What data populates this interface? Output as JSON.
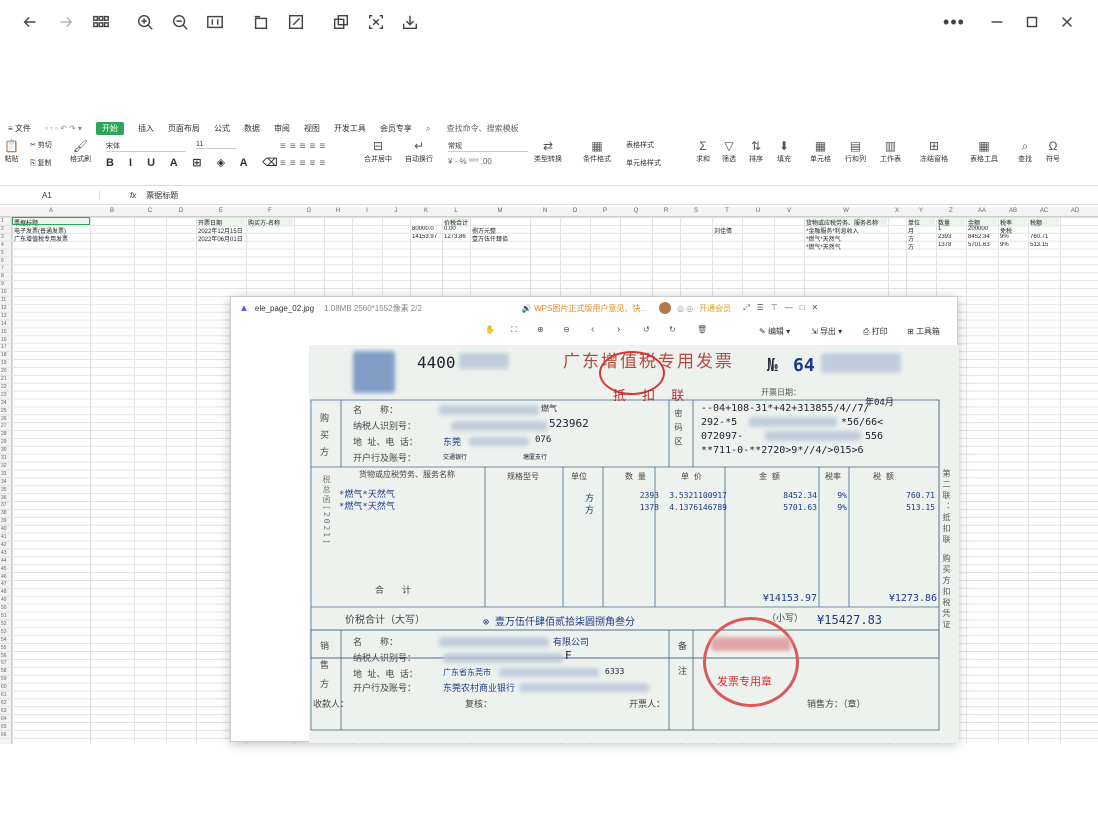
{
  "viewer": {
    "icons": [
      "back-icon",
      "forward-icon",
      "grid-icon",
      "zoom-in-icon",
      "zoom-out-icon",
      "fit-icon",
      "rotate-icon",
      "edit-icon",
      "copy-icon",
      "crop-icon",
      "download-icon",
      "more-icon",
      "minimize-icon",
      "maximize-icon",
      "close-icon"
    ]
  },
  "menu": {
    "items": [
      "≡ 文件",
      "开始",
      "插入",
      "页面布局",
      "公式",
      "数据",
      "审阅",
      "视图",
      "开发工具",
      "会员专享",
      "查找命令、搜索模板"
    ],
    "active": "开始"
  },
  "ribbon": {
    "paste": "粘贴",
    "cut": "剪切",
    "copy": "复制",
    "format_painter": "格式刷",
    "font": "宋体",
    "size": "11",
    "merge": "合并居中",
    "wrap": "自动换行",
    "number_format": "常规",
    "type_convert": "类型转换",
    "cond_format": "条件格式",
    "table_style": "表格样式",
    "cell_style": "单元格样式",
    "sum": "求和",
    "filter": "筛选",
    "sort": "排序",
    "fill": "填充",
    "cell": "单元格",
    "rowcol": "行和列",
    "sheet": "工作表",
    "freeze": "冻结窗格",
    "table_tools": "表格工具",
    "find": "查找",
    "symbol": "符号"
  },
  "formula": {
    "cell_ref": "A1",
    "fx": "fx",
    "content": "票据标题"
  },
  "columns": [
    "A",
    "B",
    "C",
    "D",
    "E",
    "F",
    "G",
    "H",
    "I",
    "J",
    "K",
    "L",
    "M",
    "N",
    "O",
    "P",
    "Q",
    "R",
    "S",
    "T",
    "U",
    "V",
    "W",
    "X",
    "Y",
    "Z",
    "AA",
    "AB",
    "AC",
    "AD"
  ],
  "rows": [
    {
      "n": "1",
      "a": "票据标题",
      "e": "开票日期",
      "f": "购买方-名称",
      "l": "价税合计",
      "w": "货物或应税劳务、服务名称",
      "y": "单位",
      "z": "数量",
      "aa": "金额",
      "ab": "税率",
      "ac": "税额"
    },
    {
      "n": "2",
      "a": "电子发票(普通发票)",
      "e": "2022年12月15日",
      "k": "80000.0",
      "l": "0.00",
      "m": "捌万元整",
      "t": "刘佳倩",
      "w": "*金融服务*利息收入",
      "y": "月",
      "z": "1",
      "aa": "200000",
      "ab": "免税"
    },
    {
      "n": "3",
      "a": "广东增值税专用发票",
      "e": "2022年06月01日",
      "k": "14153.97",
      "l": "1273.86",
      "m": "壹万伍仟肆佰",
      "w": "*燃气*天然气",
      "y": "方",
      "z": "2393",
      "aa": "8452.34",
      "ab": "9%",
      "ac": "760.71"
    },
    {
      "n": "4",
      "w": "*燃气*天然气",
      "y": "方",
      "z": "1378",
      "aa": "5701.63",
      "ab": "9%",
      "ac": "513.15"
    }
  ],
  "image_viewer": {
    "filename": "ele_page_02.jpg",
    "meta": "1.08MB 2560*1552像素 2/2",
    "ad": "WPS图片正式版用户意见，快...",
    "open_member": "开通会员",
    "tools": {
      "edit": "编辑",
      "export": "导出",
      "print": "打印",
      "toolbox": "工具箱"
    }
  },
  "invoice": {
    "code": "4400",
    "title": "广东增值税专用发票",
    "no_prefix": "№",
    "no": "64",
    "copy_label": "抵 扣 联",
    "date_label": "开票日期：",
    "date_tail": "年04月",
    "buyer_name_label": "名　　称：",
    "buyer_name_tail": "燃气",
    "taxid_label": "纳税人识别号：",
    "taxid": "523962",
    "addr_label": "地 址、电 话：",
    "addr": "东莞",
    "addr_num": "076",
    "bank_label": "开户行及账号：",
    "bank": "交通银行",
    "bank_tail": "塘厦支行",
    "cipher": [
      "--04+108-31*+42+313855/4//7/",
      "292-*5",
      "*56/66<",
      "072097-",
      "556",
      "**711-0-**2720>9*//4/>015>6"
    ],
    "header_goods": "货物或应税劳务、服务名称",
    "header_spec": "规格型号",
    "header_unit": "单位",
    "header_qty": "数 量",
    "header_price": "单 价",
    "header_amount": "金 额",
    "header_rate": "税率",
    "header_tax": "税 额",
    "items": [
      {
        "name": "*燃气*天然气",
        "unit": "方",
        "qty": "2393",
        "price": "3.5321100917",
        "amount": "8452.34",
        "rate": "9%",
        "tax": "760.71"
      },
      {
        "name": "*燃气*天然气",
        "unit": "方",
        "qty": "1378",
        "price": "4.1376146789",
        "amount": "5701.63",
        "rate": "9%",
        "tax": "513.15"
      }
    ],
    "total_label": "合　　计",
    "total_amount": "¥14153.97",
    "total_tax": "¥1273.86",
    "grand_label": "价税合计（大写）",
    "grand_cn": "壹万伍仟肆佰贰拾柒圆捌角叁分",
    "small": "（小写）",
    "grand_num": "¥15427.83",
    "seller_name_tail": "有限公司",
    "seller_taxid_tail": "F",
    "seller_addr": "广东省东莞市",
    "seller_addr_tail": "6333",
    "seller_bank": "东莞农村商业银行",
    "payee": "收款人：",
    "reviewer": "复核：",
    "drawer": "开票人：",
    "seller_label": "销售方：（章）",
    "stamp_text": "发票专用章",
    "side_label": "第二联：抵扣联 购买方扣税凭证",
    "left_side": "税总函[2021]",
    "seller_group": "销售方",
    "buyer_group": "购买方",
    "remark": "备注",
    "cipher_group": "密码区"
  }
}
